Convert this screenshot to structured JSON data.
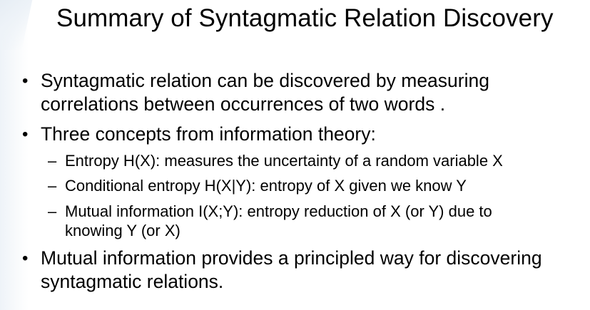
{
  "slide": {
    "title": "Summary of Syntagmatic Relation Discovery",
    "bullet_glyph": "•",
    "dash_glyph": "–",
    "points": [
      {
        "lines": [
          "Syntagmatic relation can be discovered by measuring",
          "correlations between occurrences of two words ."
        ]
      },
      {
        "lines": [
          "Three concepts from information theory:"
        ],
        "subpoints": [
          {
            "lines": [
              "Entropy H(X): measures the uncertainty of a random variable X"
            ]
          },
          {
            "lines": [
              "Conditional entropy H(X|Y): entropy of X given we know Y"
            ]
          },
          {
            "lines": [
              "Mutual information I(X;Y): entropy reduction of X (or Y) due to",
              "knowing Y (or X)"
            ]
          }
        ]
      },
      {
        "lines": [
          "Mutual information provides a principled way for discovering",
          "syntagmatic relations."
        ]
      }
    ]
  }
}
